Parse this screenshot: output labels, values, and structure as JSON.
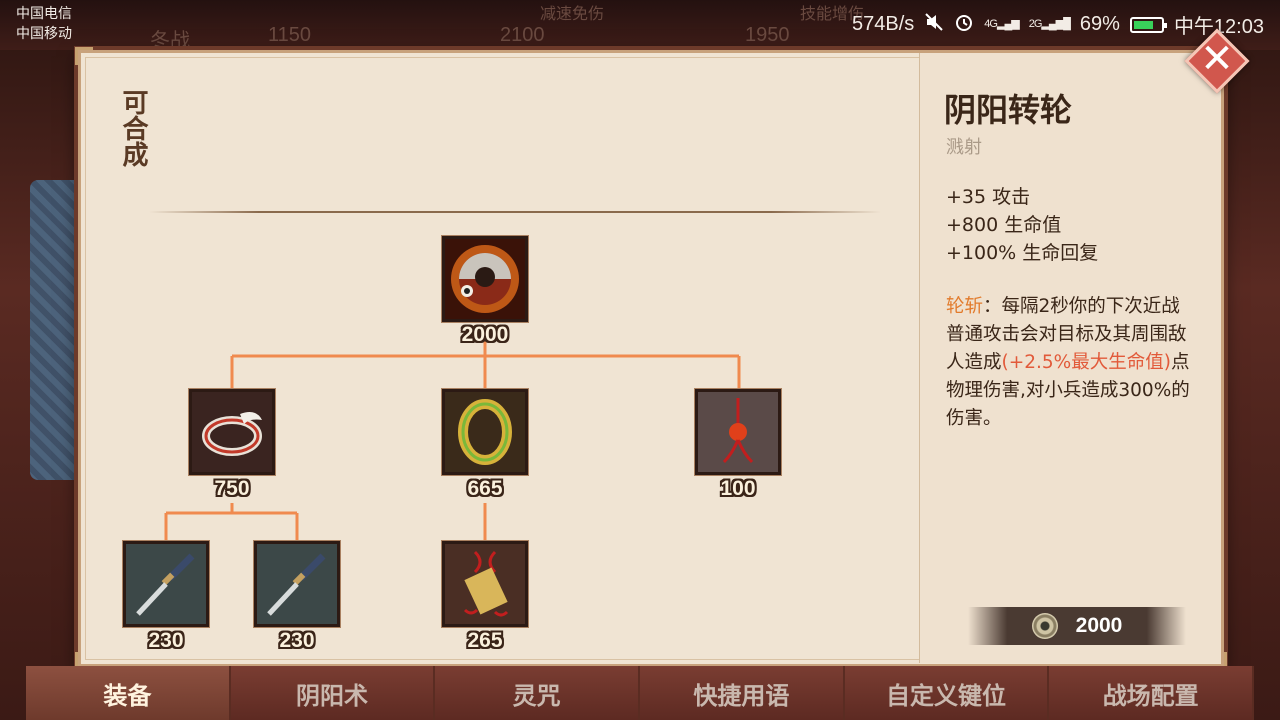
{
  "status_bar": {
    "carrier_1": "中国电信",
    "carrier_2": "中国移动",
    "net_speed": "574B/s",
    "signal_1": "4G",
    "signal_2": "2G",
    "battery": "69%",
    "time": "中午12:03"
  },
  "background": {
    "ghost_texts": [
      "冬战",
      "1150",
      "2100",
      "1950",
      "减速免伤",
      "技能增伤"
    ]
  },
  "panel": {
    "craft_label": "可合成",
    "tree": {
      "root": {
        "name": "阴阳转轮",
        "price": "2000",
        "icon": "yinyang-wheel-icon"
      },
      "tier2": [
        {
          "price": "750",
          "icon": "feather-ring-icon"
        },
        {
          "price": "665",
          "icon": "gold-ring-icon"
        },
        {
          "price": "100",
          "icon": "red-charm-icon"
        }
      ],
      "tier3": [
        {
          "price": "230",
          "icon": "katana-icon"
        },
        {
          "price": "230",
          "icon": "katana-icon"
        },
        {
          "price": "265",
          "icon": "talisman-icon"
        }
      ]
    }
  },
  "detail": {
    "title": "阴阳转轮",
    "subtitle": "溅射",
    "stats": [
      "+35 攻击",
      "+800 生命值",
      "+100% 生命回复"
    ],
    "skill_name": "轮斩",
    "desc_part1": "：每隔2秒你的下次近战普通攻击会对目标及其周围敌人造成",
    "desc_highlight": "(+2.5%最大生命值)",
    "desc_part2": "点物理伤害,对小兵造成300%的伤害。",
    "cost": "2000",
    "cost_icon": "coin-icon"
  },
  "close": {
    "label": "✕"
  },
  "tabs": [
    {
      "label": "装备",
      "active": true
    },
    {
      "label": "阴阳术",
      "active": false
    },
    {
      "label": "灵咒",
      "active": false
    },
    {
      "label": "快捷用语",
      "active": false
    },
    {
      "label": "自定义键位",
      "active": false
    },
    {
      "label": "战场配置",
      "active": false
    }
  ],
  "colors": {
    "connector": "#f08a4e",
    "panel_bg": "#f0e4d3",
    "accent_orange": "#e27b2c",
    "accent_red": "#e25a3a"
  }
}
